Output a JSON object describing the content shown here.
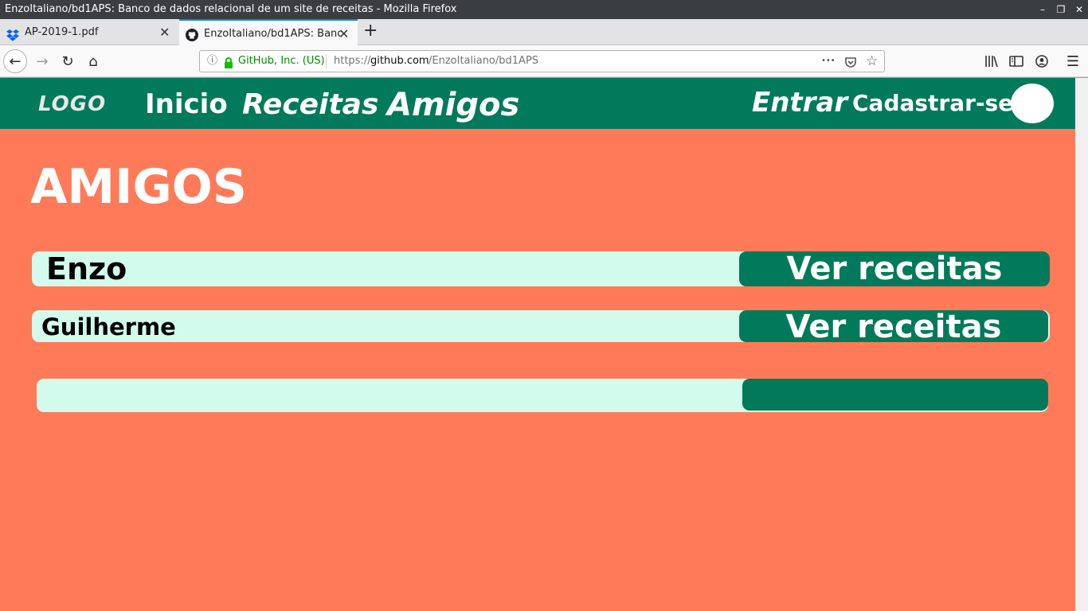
{
  "window": {
    "title": "EnzoItaliano/bd1APS: Banco de dados relacional de um site de receitas - Mozilla Firefox",
    "controls": {
      "minimize": "–",
      "restore": "❐",
      "close": "✕"
    }
  },
  "tabs": [
    {
      "title": "AP-2019-1.pdf",
      "icon": "dropbox-icon",
      "close": "✕"
    },
    {
      "title": "EnzoItaliano/bd1APS: Banc",
      "icon": "github-icon",
      "close": "✕"
    }
  ],
  "new_tab_label": "+",
  "toolbar": {
    "back": "←",
    "forward": "→",
    "reload": "↻",
    "home": "⌂",
    "more": "•••",
    "star": "☆",
    "menu": "☰"
  },
  "urlbar": {
    "info": "ⓘ",
    "identity": "GitHub, Inc. (US)",
    "url_scheme": "https://",
    "url_domain": "github.com",
    "url_path": "/EnzoItaliano/bd1APS"
  },
  "site": {
    "logo": "LOGO",
    "nav": {
      "inicio": "Inicio",
      "receitas": "Receitas",
      "amigos": "Amigos"
    },
    "auth": {
      "entrar": "Entrar",
      "cadastrar": "Cadastrar-se"
    }
  },
  "page_title": "AMIGOS",
  "friends": [
    {
      "name": "Enzo",
      "button": "Ver receitas"
    },
    {
      "name": "Guilherme",
      "button": "Ver receitas"
    },
    {
      "name": "",
      "button": ""
    }
  ],
  "colors": {
    "page_bg": "#ff7a59",
    "header_bg": "#007a5a",
    "row_bg": "#d2fbee",
    "button_bg": "#007a5a",
    "text_light": "#ffffff"
  }
}
